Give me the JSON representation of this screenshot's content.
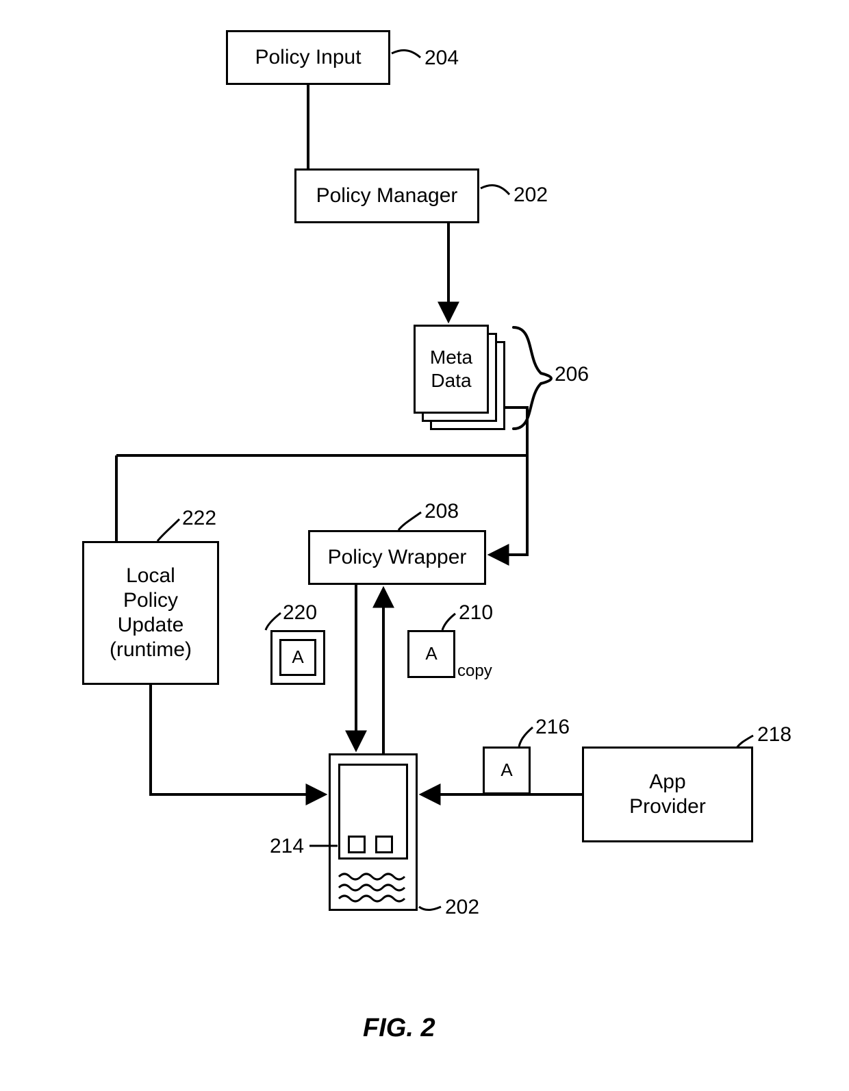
{
  "figure_label": "FIG. 2",
  "nodes": {
    "policy_input": {
      "label": "Policy Input",
      "ref": "204"
    },
    "policy_manager": {
      "label": "Policy Manager",
      "ref": "202"
    },
    "meta_data": {
      "label_line1": "Meta",
      "label_line2": "Data",
      "ref": "206"
    },
    "policy_wrapper": {
      "label": "Policy Wrapper",
      "ref": "208"
    },
    "local_policy_update": {
      "label_line1": "Local",
      "label_line2": "Policy",
      "label_line3": "Update",
      "label_line4": "(runtime)",
      "ref": "222"
    },
    "app_a_wrapped": {
      "label": "A",
      "ref": "220"
    },
    "app_a_copy": {
      "label": "A",
      "ref": "210",
      "suffix": "copy"
    },
    "app_a_from_provider": {
      "label": "A",
      "ref": "216"
    },
    "app_provider": {
      "label_line1": "App",
      "label_line2": "Provider",
      "ref": "218"
    },
    "device": {
      "ref_inner": "214",
      "ref_outer": "202"
    }
  }
}
